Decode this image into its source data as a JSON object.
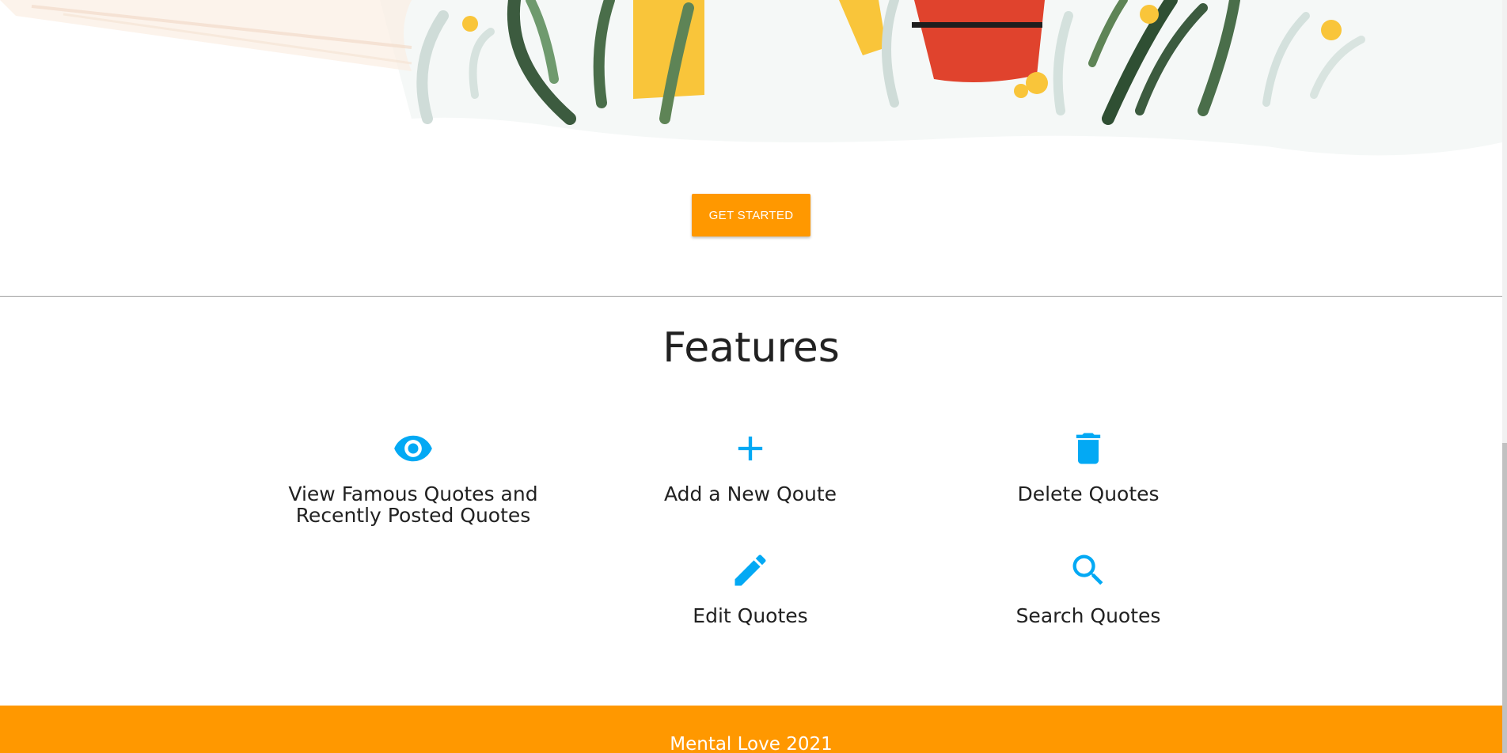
{
  "hero": {
    "illustration": "potted-plants-illustration"
  },
  "cta": {
    "label": "GET STARTED"
  },
  "features": {
    "title": "Features",
    "icon_color": "#03a9f4",
    "items": [
      {
        "icon": "eye-icon",
        "label": "View Famous Quotes and Recently Posted Quotes"
      },
      {
        "icon": "plus-icon",
        "label": "Add a New Qoute"
      },
      {
        "icon": "trash-icon",
        "label": "Delete Quotes"
      },
      {
        "icon": "pencil-icon",
        "label": "Edit Quotes"
      },
      {
        "icon": "search-icon",
        "label": "Search Quotes"
      }
    ]
  },
  "footer": {
    "text": "Mental Love 2021",
    "color": "#ff9800"
  }
}
